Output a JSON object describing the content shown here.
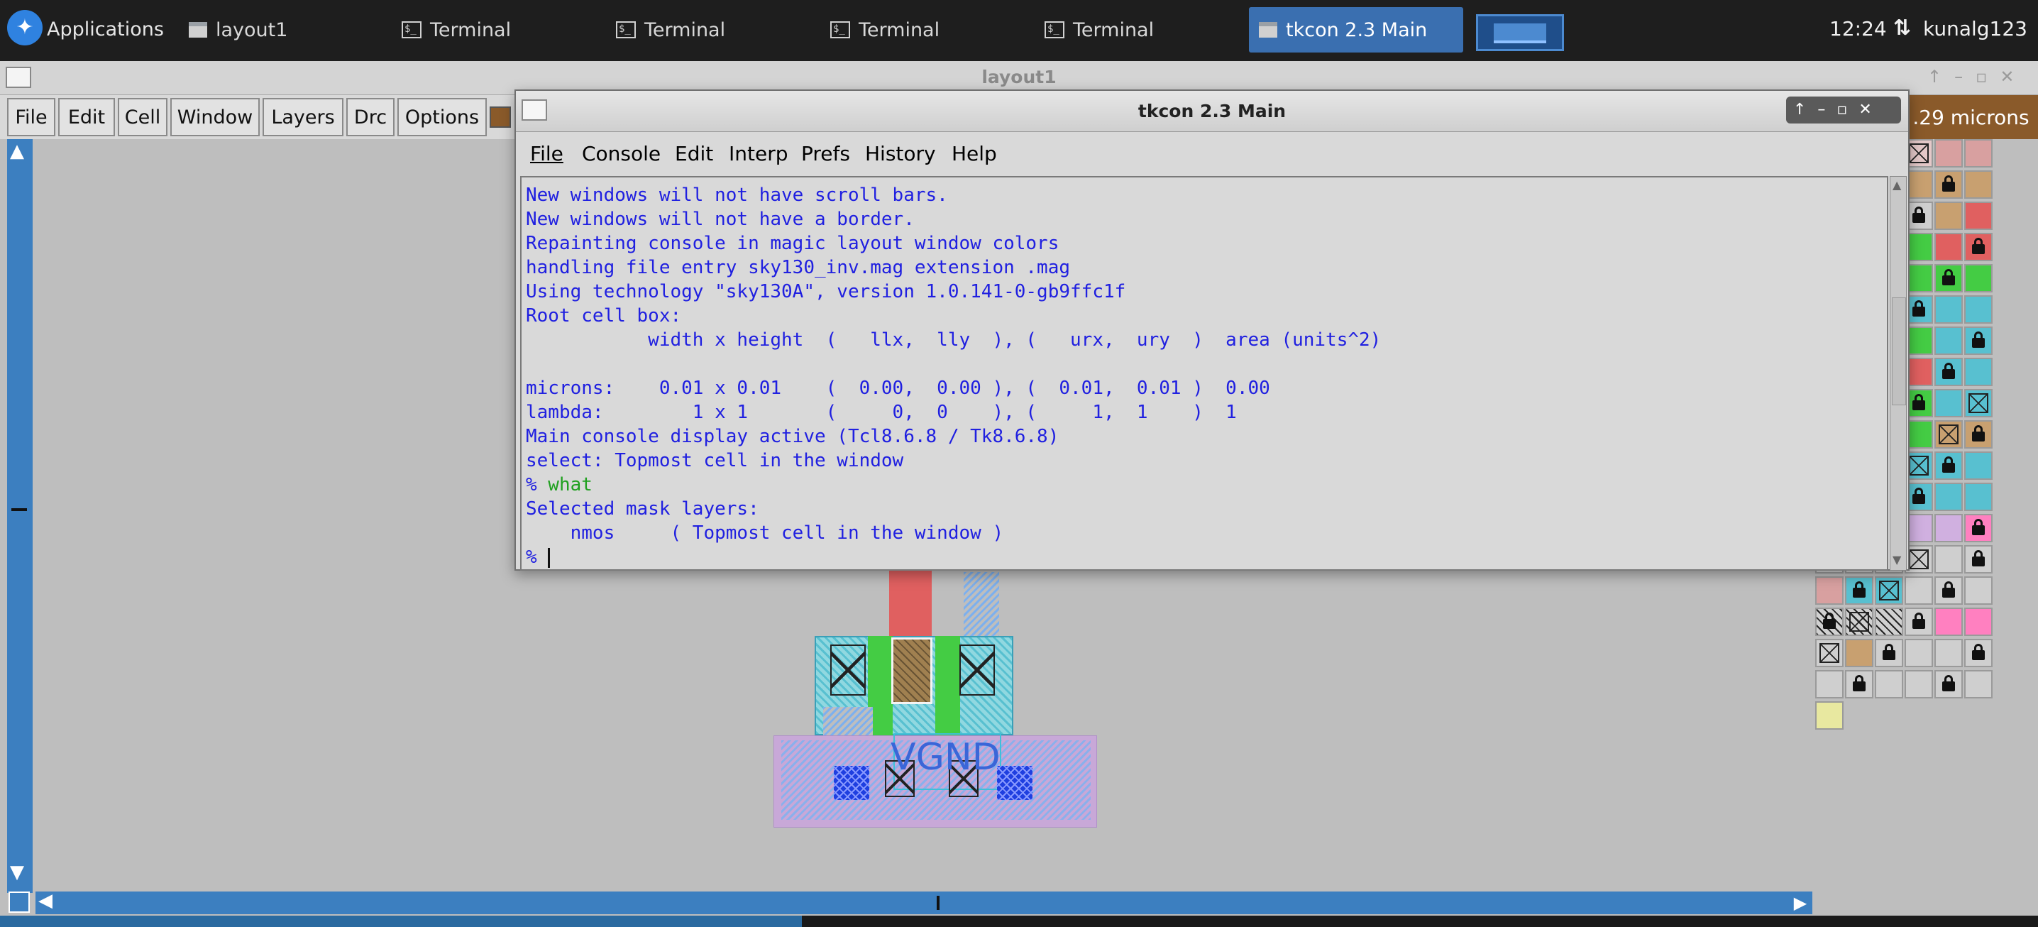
{
  "panel": {
    "applications_label": "Applications",
    "tasks": [
      {
        "label": "layout1",
        "icon": "window-icon"
      },
      {
        "label": "Terminal",
        "icon": "terminal-icon"
      },
      {
        "label": "Terminal",
        "icon": "terminal-icon"
      },
      {
        "label": "Terminal",
        "icon": "terminal-icon"
      },
      {
        "label": "Terminal",
        "icon": "terminal-icon"
      },
      {
        "label": "tkcon 2.3 Main",
        "icon": "window-icon",
        "active": true
      }
    ],
    "clock": "12:24",
    "user": "kunalg123",
    "active_color": "#3a6fb0"
  },
  "layout_window": {
    "title": "layout1",
    "menu": [
      "File",
      "Edit",
      "Cell",
      "Window",
      "Layers",
      "Drc",
      "Options"
    ],
    "box_size": ".29 microns",
    "label_vgnd": "VGND"
  },
  "tkcon": {
    "title": "tkcon 2.3 Main",
    "menu": [
      "File",
      "Console",
      "Edit",
      "Interp",
      "Prefs",
      "History",
      "Help"
    ],
    "lines": [
      "New windows will not have scroll bars.",
      "New windows will not have a border.",
      "Repainting console in magic layout window colors",
      "handling file entry sky130_inv.mag extension .mag",
      "Using technology \"sky130A\", version 1.0.141-0-gb9ffc1f",
      "Root cell box:",
      "           width x height  (   llx,  lly  ), (   urx,  ury  )  area (units^2)",
      "",
      "microns:    0.01 x 0.01    (  0.00,  0.00 ), (  0.01,  0.01 )  0.00",
      "lambda:        1 x 1       (     0,  0    ), (     1,  1    )  1",
      "Main console display active (Tcl8.6.8 / Tk8.6.8)",
      "select: Topmost cell in the window"
    ],
    "prompt": "%",
    "command": " what",
    "result_lines": [
      "Selected mask layers:",
      "    nmos     ( Topmost cell in the window )"
    ],
    "text_color": "#2020e0",
    "command_color": "#20a020"
  }
}
